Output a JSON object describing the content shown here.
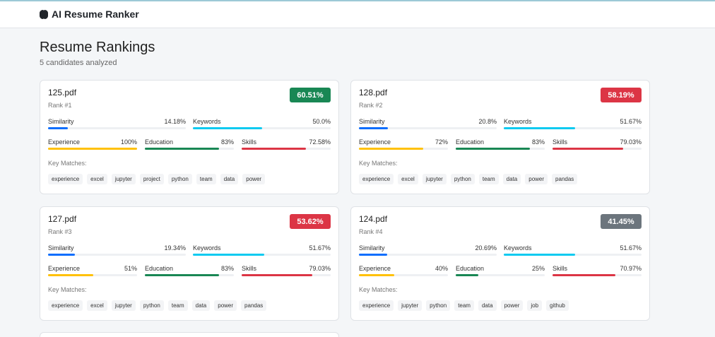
{
  "app": {
    "title": "AI Resume Ranker"
  },
  "page": {
    "title": "Resume Rankings",
    "subtitle": "5 candidates analyzed",
    "key_matches_label": "Key Matches:"
  },
  "metric_labels": {
    "similarity": "Similarity",
    "keywords": "Keywords",
    "experience": "Experience",
    "education": "Education",
    "skills": "Skills"
  },
  "colors": {
    "similarity": "#0d6efd",
    "keywords": "#0dcaf0",
    "experience": "#ffc107",
    "education": "#198754",
    "skills": "#dc3545"
  },
  "candidates": [
    {
      "file": "125.pdf",
      "rank": "Rank #1",
      "score": "60.51%",
      "score_color": "#198754",
      "metrics": {
        "similarity": {
          "text": "14.18%",
          "value": 14.18
        },
        "keywords": {
          "text": "50.0%",
          "value": 50.0
        },
        "experience": {
          "text": "100%",
          "value": 100
        },
        "education": {
          "text": "83%",
          "value": 83
        },
        "skills": {
          "text": "72.58%",
          "value": 72.58
        }
      },
      "matches": [
        "experience",
        "excel",
        "jupyter",
        "project",
        "python",
        "team",
        "data",
        "power"
      ]
    },
    {
      "file": "128.pdf",
      "rank": "Rank #2",
      "score": "58.19%",
      "score_color": "#dc3545",
      "metrics": {
        "similarity": {
          "text": "20.8%",
          "value": 20.8
        },
        "keywords": {
          "text": "51.67%",
          "value": 51.67
        },
        "experience": {
          "text": "72%",
          "value": 72
        },
        "education": {
          "text": "83%",
          "value": 83
        },
        "skills": {
          "text": "79.03%",
          "value": 79.03
        }
      },
      "matches": [
        "experience",
        "excel",
        "jupyter",
        "python",
        "team",
        "data",
        "power",
        "pandas"
      ]
    },
    {
      "file": "127.pdf",
      "rank": "Rank #3",
      "score": "53.62%",
      "score_color": "#dc3545",
      "metrics": {
        "similarity": {
          "text": "19.34%",
          "value": 19.34
        },
        "keywords": {
          "text": "51.67%",
          "value": 51.67
        },
        "experience": {
          "text": "51%",
          "value": 51
        },
        "education": {
          "text": "83%",
          "value": 83
        },
        "skills": {
          "text": "79.03%",
          "value": 79.03
        }
      },
      "matches": [
        "experience",
        "excel",
        "jupyter",
        "python",
        "team",
        "data",
        "power",
        "pandas"
      ]
    },
    {
      "file": "124.pdf",
      "rank": "Rank #4",
      "score": "41.45%",
      "score_color": "#6c757d",
      "metrics": {
        "similarity": {
          "text": "20.69%",
          "value": 20.69
        },
        "keywords": {
          "text": "51.67%",
          "value": 51.67
        },
        "experience": {
          "text": "40%",
          "value": 40
        },
        "education": {
          "text": "25%",
          "value": 25
        },
        "skills": {
          "text": "70.97%",
          "value": 70.97
        }
      },
      "matches": [
        "experience",
        "jupyter",
        "python",
        "team",
        "data",
        "power",
        "job",
        "github"
      ]
    }
  ]
}
